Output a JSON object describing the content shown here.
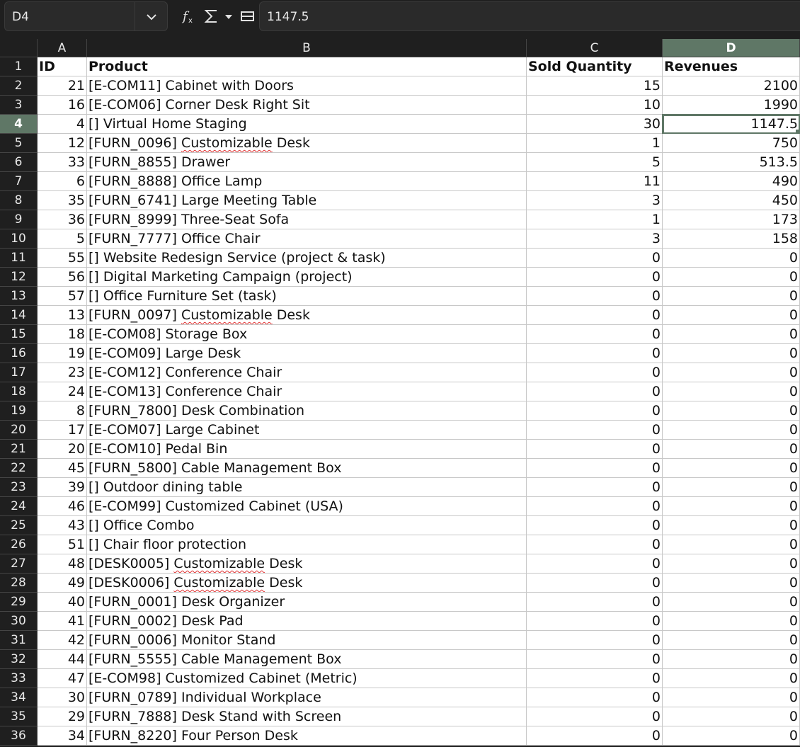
{
  "formula_bar": {
    "name_box": "D4",
    "formula": "1147.5",
    "icons": [
      "function-wizard-icon",
      "sum-icon",
      "dropdown-arrow-icon",
      "formula-equals-icon"
    ]
  },
  "columns": [
    "A",
    "B",
    "C",
    "D"
  ],
  "selected_column": "D",
  "selected_row": "4",
  "rows": [
    {
      "n": "1",
      "a": "ID",
      "b": "Product",
      "c": "Sold Quantity",
      "d": "Revenues",
      "header": true
    },
    {
      "n": "2",
      "a": "21",
      "b": "[E-COM11] Cabinet with Doors",
      "c": "15",
      "d": "2100"
    },
    {
      "n": "3",
      "a": "16",
      "b": "[E-COM06] Corner Desk Right Sit",
      "c": "10",
      "d": "1990"
    },
    {
      "n": "4",
      "a": "4",
      "b": "[] Virtual Home Staging",
      "c": "30",
      "d": "1147.5"
    },
    {
      "n": "5",
      "a": "12",
      "b": "[FURN_0096] Customizable Desk",
      "c": "1",
      "d": "750"
    },
    {
      "n": "6",
      "a": "33",
      "b": "[FURN_8855] Drawer",
      "c": "5",
      "d": "513.5"
    },
    {
      "n": "7",
      "a": "6",
      "b": "[FURN_8888] Office Lamp",
      "c": "11",
      "d": "490"
    },
    {
      "n": "8",
      "a": "35",
      "b": "[FURN_6741] Large Meeting Table",
      "c": "3",
      "d": "450"
    },
    {
      "n": "9",
      "a": "36",
      "b": "[FURN_8999] Three-Seat Sofa",
      "c": "1",
      "d": "173"
    },
    {
      "n": "10",
      "a": "5",
      "b": "[FURN_7777] Office Chair",
      "c": "3",
      "d": "158"
    },
    {
      "n": "11",
      "a": "55",
      "b": "[] Website Redesign Service (project & task)",
      "c": "0",
      "d": "0"
    },
    {
      "n": "12",
      "a": "56",
      "b": "[] Digital Marketing Campaign (project)",
      "c": "0",
      "d": "0"
    },
    {
      "n": "13",
      "a": "57",
      "b": "[] Office Furniture Set (task)",
      "c": "0",
      "d": "0"
    },
    {
      "n": "14",
      "a": "13",
      "b": "[FURN_0097] Customizable Desk",
      "c": "0",
      "d": "0"
    },
    {
      "n": "15",
      "a": "18",
      "b": "[E-COM08] Storage Box",
      "c": "0",
      "d": "0"
    },
    {
      "n": "16",
      "a": "19",
      "b": "[E-COM09] Large Desk",
      "c": "0",
      "d": "0"
    },
    {
      "n": "17",
      "a": "23",
      "b": "[E-COM12] Conference Chair",
      "c": "0",
      "d": "0"
    },
    {
      "n": "18",
      "a": "24",
      "b": "[E-COM13] Conference Chair",
      "c": "0",
      "d": "0"
    },
    {
      "n": "19",
      "a": "8",
      "b": "[FURN_7800] Desk Combination",
      "c": "0",
      "d": "0"
    },
    {
      "n": "20",
      "a": "17",
      "b": "[E-COM07] Large Cabinet",
      "c": "0",
      "d": "0"
    },
    {
      "n": "21",
      "a": "20",
      "b": "[E-COM10] Pedal Bin",
      "c": "0",
      "d": "0"
    },
    {
      "n": "22",
      "a": "45",
      "b": "[FURN_5800] Cable Management Box",
      "c": "0",
      "d": "0"
    },
    {
      "n": "23",
      "a": "39",
      "b": "[] Outdoor dining table",
      "c": "0",
      "d": "0"
    },
    {
      "n": "24",
      "a": "46",
      "b": "[E-COM99] Customized Cabinet (USA)",
      "c": "0",
      "d": "0"
    },
    {
      "n": "25",
      "a": "43",
      "b": "[] Office Combo",
      "c": "0",
      "d": "0"
    },
    {
      "n": "26",
      "a": "51",
      "b": "[] Chair floor protection",
      "c": "0",
      "d": "0"
    },
    {
      "n": "27",
      "a": "48",
      "b": "[DESK0005] Customizable Desk",
      "c": "0",
      "d": "0"
    },
    {
      "n": "28",
      "a": "49",
      "b": "[DESK0006] Customizable Desk",
      "c": "0",
      "d": "0"
    },
    {
      "n": "29",
      "a": "40",
      "b": "[FURN_0001] Desk Organizer",
      "c": "0",
      "d": "0"
    },
    {
      "n": "30",
      "a": "41",
      "b": "[FURN_0002] Desk Pad",
      "c": "0",
      "d": "0"
    },
    {
      "n": "31",
      "a": "42",
      "b": "[FURN_0006] Monitor Stand",
      "c": "0",
      "d": "0"
    },
    {
      "n": "32",
      "a": "44",
      "b": "[FURN_5555] Cable Management Box",
      "c": "0",
      "d": "0"
    },
    {
      "n": "33",
      "a": "47",
      "b": "[E-COM98] Customized Cabinet (Metric)",
      "c": "0",
      "d": "0"
    },
    {
      "n": "34",
      "a": "30",
      "b": "[FURN_0789] Individual Workplace",
      "c": "0",
      "d": "0"
    },
    {
      "n": "35",
      "a": "29",
      "b": "[FURN_7888] Desk Stand with Screen",
      "c": "0",
      "d": "0"
    },
    {
      "n": "36",
      "a": "34",
      "b": "[FURN_8220] Four Person Desk",
      "c": "0",
      "d": "0"
    }
  ]
}
